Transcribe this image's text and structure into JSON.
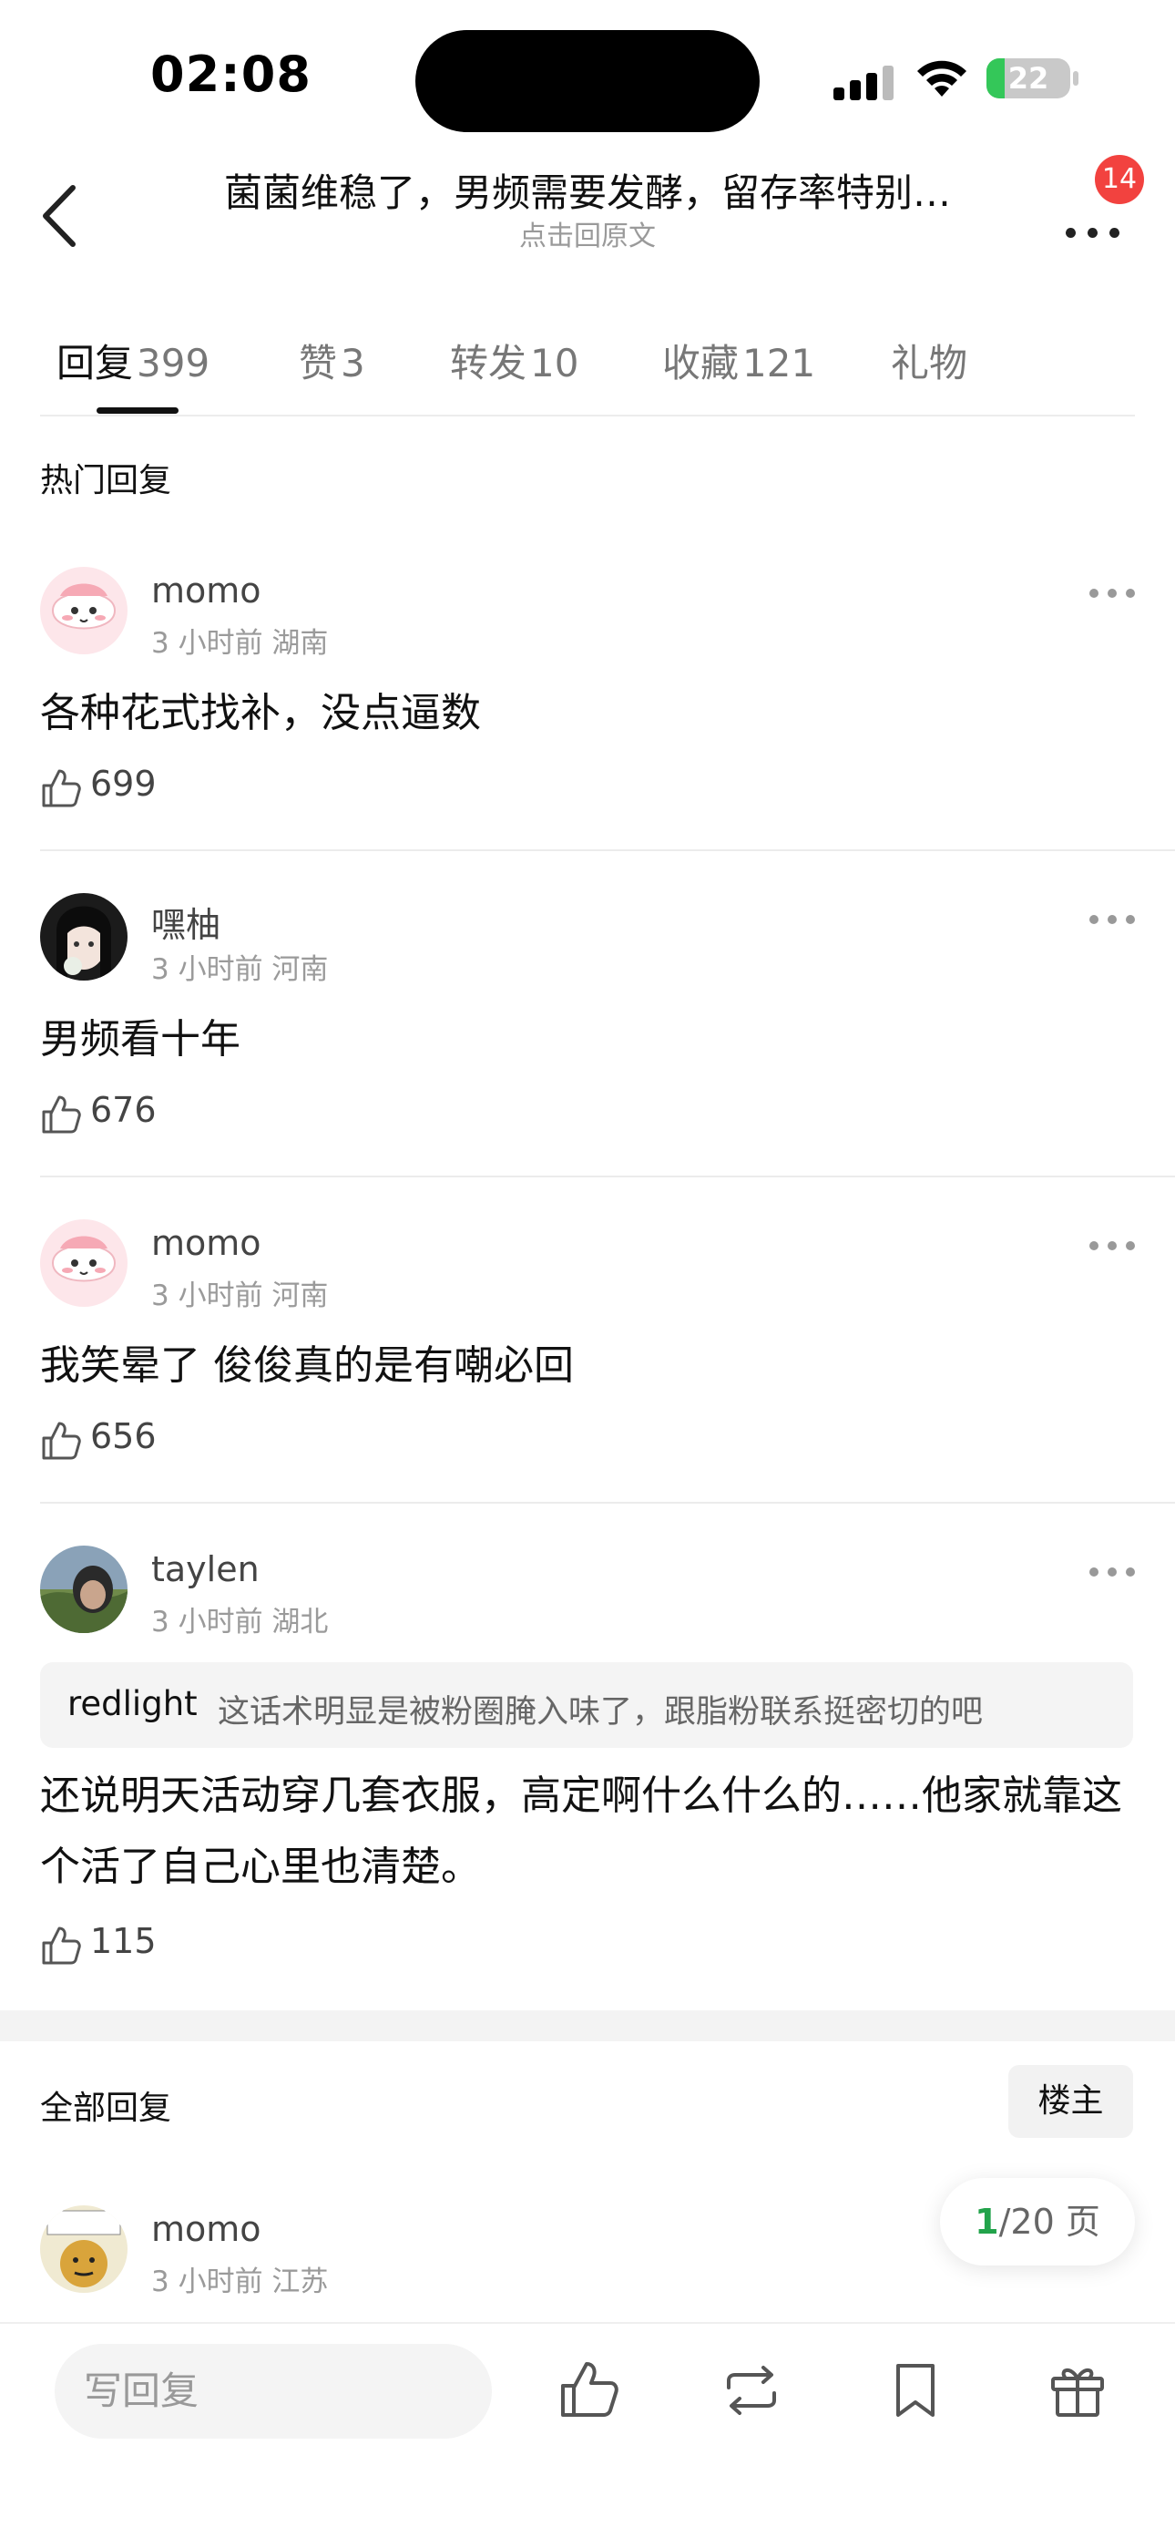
{
  "status_bar": {
    "time": "02:08",
    "battery": "22",
    "battery_level": 0.22
  },
  "nav": {
    "title": "菌菌维稳了，男频需要发酵，留存率特别…",
    "subtitle": "点击回原文",
    "notification_count": "14"
  },
  "tabs": [
    {
      "label": "回复",
      "count": "399",
      "active": true
    },
    {
      "label": "赞",
      "count": "3"
    },
    {
      "label": "转发",
      "count": "10"
    },
    {
      "label": "收藏",
      "count": "121"
    },
    {
      "label": "礼物",
      "count": ""
    }
  ],
  "hot": {
    "section_title": "热门回复",
    "comments": [
      {
        "user": "momo",
        "meta": "3 小时前 湖南",
        "text": "各种花式找补，没点逼数",
        "likes": "699",
        "avatar": "pink-blob-avatar"
      },
      {
        "user": "嘿柚",
        "meta": "3 小时前 河南",
        "text": "男频看十年",
        "likes": "676",
        "avatar": "anime-girl-avatar"
      },
      {
        "user": "momo",
        "meta": "3 小时前 河南",
        "text": "我笑晕了 俊俊真的是有嘲必回",
        "likes": "656",
        "avatar": "pink-blob-avatar"
      },
      {
        "user": "taylen",
        "meta": "3 小时前 湖北",
        "quote_user": "redlight",
        "quote_text": "这话术明显是被粉圈腌入味了，跟脂粉联系挺密切的吧",
        "text": "还说明天活动穿几套衣服，高定啊什么什么的……他家就靠这个活了自己心里也清楚。",
        "likes": "115",
        "avatar": "landscape-avatar"
      }
    ]
  },
  "all": {
    "section_title": "全部回复",
    "owner_filter": "楼主",
    "pager_current": "1",
    "pager_rest": "/20 页",
    "first": {
      "user": "momo",
      "meta": "3 小时前 江苏",
      "avatar": "meme-avatar"
    }
  },
  "bottom": {
    "reply_placeholder": "写回复"
  },
  "colors": {
    "accent_green": "#22a34b",
    "badge_red": "#f2423f",
    "battery_green": "#34c759"
  }
}
